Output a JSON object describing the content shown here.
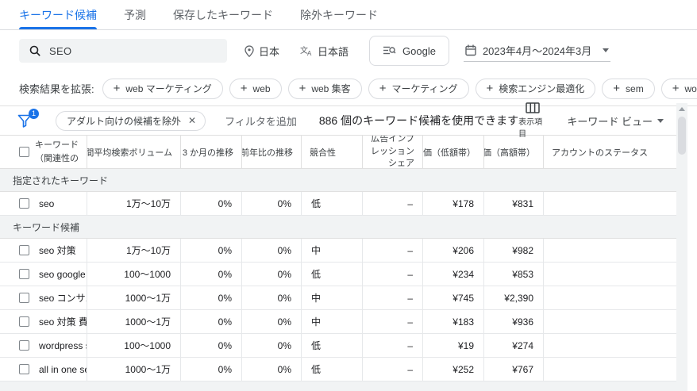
{
  "colors": {
    "accent": "#1a73e8",
    "section_bg": "#f1f3f4"
  },
  "tabs": [
    {
      "id": "keyword-ideas",
      "label": "キーワード候補",
      "active": true
    },
    {
      "id": "forecast",
      "label": "予測",
      "active": false
    },
    {
      "id": "saved-keywords",
      "label": "保存したキーワード",
      "active": false
    },
    {
      "id": "negative-keywords",
      "label": "除外キーワード",
      "active": false
    }
  ],
  "toolbar": {
    "search_query": "SEO",
    "location": "日本",
    "language": "日本語",
    "network": "Google",
    "date_range": "2023年4月～2024年3月"
  },
  "expand": {
    "label": "検索結果を拡張:",
    "chips": [
      "web マーケティング",
      "web",
      "web 集客",
      "マーケティング",
      "検索エンジン最適化",
      "sem",
      "wordpress"
    ]
  },
  "filter_bar": {
    "active_filter_count": "1",
    "filter_chip": "アダルト向けの候補を除外",
    "add_filter_label": "フィルタを追加",
    "result_count_text": "886 個のキーワード候補を使用できます",
    "columns_label": "表示項目",
    "view_label": "キーワード ビュー"
  },
  "table": {
    "headers": [
      {
        "key": "keyword",
        "label": "キーワード",
        "sublabel": "（関連性の高い順）"
      },
      {
        "key": "volume",
        "label": "月間平均検索ボリューム"
      },
      {
        "key": "three_month",
        "label": "3 か月の推移"
      },
      {
        "key": "yoy",
        "label": "前年比の推移"
      },
      {
        "key": "competition",
        "label": "競合性"
      },
      {
        "key": "impression_share",
        "label": "広告インプレッション シェア"
      },
      {
        "key": "top_bid_low",
        "label": "上部に掲載された広告の入札単価（低額帯）"
      },
      {
        "key": "top_bid_high",
        "label": "上部に掲載された広告の入札単価（高額帯）"
      },
      {
        "key": "status",
        "label": "アカウントのステータス"
      }
    ],
    "sections": [
      {
        "title": "指定されたキーワード",
        "rows": [
          {
            "keyword": "seo",
            "volume": "1万～10万",
            "three_month": "0%",
            "yoy": "0%",
            "competition": "低",
            "impression_share": "–",
            "top_bid_low": "¥178",
            "top_bid_high": "¥831",
            "status": ""
          }
        ]
      },
      {
        "title": "キーワード候補",
        "rows": [
          {
            "keyword": "seo 対策",
            "volume": "1万～10万",
            "three_month": "0%",
            "yoy": "0%",
            "competition": "中",
            "impression_share": "–",
            "top_bid_low": "¥206",
            "top_bid_high": "¥982",
            "status": ""
          },
          {
            "keyword": "seo google",
            "volume": "100～1000",
            "three_month": "0%",
            "yoy": "0%",
            "competition": "低",
            "impression_share": "–",
            "top_bid_low": "¥234",
            "top_bid_high": "¥853",
            "status": ""
          },
          {
            "keyword": "seo コンサル",
            "volume": "1000～1万",
            "three_month": "0%",
            "yoy": "0%",
            "competition": "中",
            "impression_share": "–",
            "top_bid_low": "¥745",
            "top_bid_high": "¥2,390",
            "status": ""
          },
          {
            "keyword": "seo 対策 費用",
            "volume": "1000～1万",
            "three_month": "0%",
            "yoy": "0%",
            "competition": "中",
            "impression_share": "–",
            "top_bid_low": "¥183",
            "top_bid_high": "¥936",
            "status": ""
          },
          {
            "keyword": "wordpress seo",
            "volume": "100～1000",
            "three_month": "0%",
            "yoy": "0%",
            "competition": "低",
            "impression_share": "–",
            "top_bid_low": "¥19",
            "top_bid_high": "¥274",
            "status": ""
          },
          {
            "keyword": "all in one seo",
            "volume": "1000～1万",
            "three_month": "0%",
            "yoy": "0%",
            "competition": "低",
            "impression_share": "–",
            "top_bid_low": "¥252",
            "top_bid_high": "¥767",
            "status": ""
          }
        ]
      }
    ]
  }
}
